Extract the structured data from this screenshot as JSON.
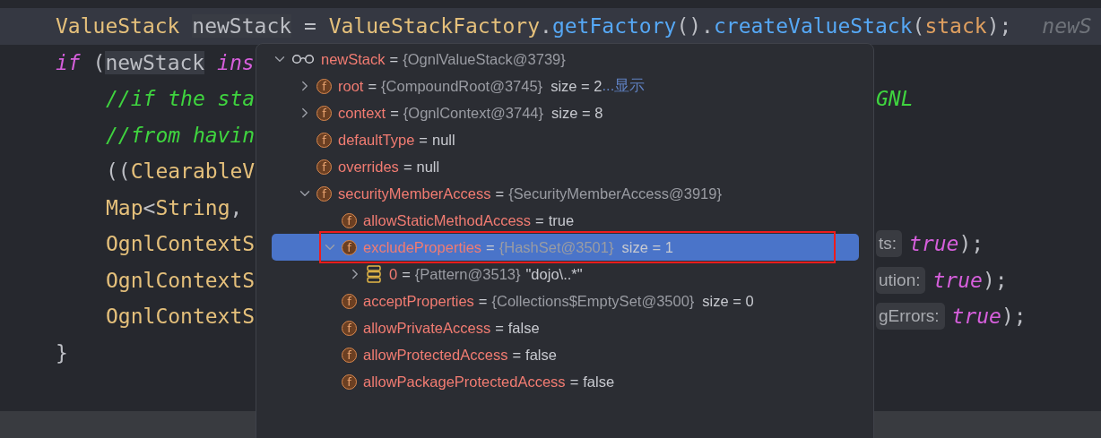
{
  "code_lines": [
    {
      "current": true,
      "kind": "method_level",
      "left": [
        {
          "text": "ValueStack ",
          "kind": "type"
        },
        {
          "text": "newStack",
          "kind": "var_highlight"
        },
        {
          "text": " = "
        },
        {
          "text": "ValueStackFactory",
          "kind": "type"
        },
        {
          "text": "."
        },
        {
          "text": "getFactory",
          "kind": "method"
        },
        {
          "text": "()."
        },
        {
          "text": "createValueStack",
          "kind": "method"
        },
        {
          "text": "("
        },
        {
          "text": "stack",
          "kind": "param"
        },
        {
          "text": ");"
        }
      ],
      "inline_hint": "newS"
    },
    {
      "current": false,
      "kind": "method_level",
      "left": [
        {
          "text": "if",
          "kind": "keyword"
        },
        {
          "text": " ("
        },
        {
          "text": "newStack",
          "kind": "var_highlight"
        },
        {
          "text": " ins",
          "kind": "keyword"
        }
      ]
    },
    {
      "current": false,
      "kind": "block_level",
      "left": [
        {
          "text": "//if the sta",
          "kind": "comment"
        }
      ],
      "right": [
        {
          "text": "GNL",
          "kind": "comment"
        }
      ]
    },
    {
      "current": false,
      "kind": "block_level",
      "left": [
        {
          "text": "//from havin",
          "kind": "comment"
        }
      ]
    },
    {
      "current": false,
      "kind": "block_level",
      "left": [
        {
          "text": "(("
        },
        {
          "text": "ClearableV",
          "kind": "type"
        }
      ]
    },
    {
      "current": false,
      "kind": "block_level",
      "left": [
        {
          "text": "Map",
          "kind": "type"
        },
        {
          "text": "<"
        },
        {
          "text": "String",
          "kind": "type"
        },
        {
          "text": ","
        }
      ]
    },
    {
      "current": false,
      "kind": "block_level",
      "left": [
        {
          "text": "OgnlContextS",
          "kind": "type"
        }
      ],
      "hint": "ts:",
      "right": [
        {
          "text": "true",
          "kind": "keyword"
        },
        {
          "text": ");"
        }
      ]
    },
    {
      "current": false,
      "kind": "block_level",
      "left": [
        {
          "text": "OgnlContextS",
          "kind": "type"
        }
      ],
      "hint": "ution:",
      "right": [
        {
          "text": "true",
          "kind": "keyword"
        },
        {
          "text": ");"
        }
      ]
    },
    {
      "current": false,
      "kind": "block_level",
      "left": [
        {
          "text": "OgnlContextS",
          "kind": "type"
        }
      ],
      "hint": "gErrors:",
      "right": [
        {
          "text": "true",
          "kind": "keyword"
        },
        {
          "text": ");"
        }
      ]
    },
    {
      "current": false,
      "kind": "method_level",
      "left": [
        {
          "text": "}"
        }
      ]
    }
  ],
  "debug_popup": {
    "tree": [
      {
        "kind": "watch",
        "name": "newStack",
        "op": "=",
        "ref": "{OgnlValueStack@3739}",
        "expanded": true,
        "selected": false,
        "children": [
          {
            "kind": "field",
            "badge": "f",
            "name": "root",
            "op": "=",
            "ref": "{CompoundRoot@3745}",
            "extra": "size = 2",
            "more": "...显示",
            "expanded": false,
            "selected": false
          },
          {
            "kind": "field",
            "badge": "f",
            "name": "context",
            "op": "=",
            "ref": "{OgnlContext@3744}",
            "extra": "size = 8",
            "expanded": false,
            "selected": false
          },
          {
            "kind": "field",
            "badge": "f",
            "name": "defaultType",
            "op": "=",
            "value": "null",
            "selected": false
          },
          {
            "kind": "field",
            "badge": "f",
            "name": "overrides",
            "op": "=",
            "value": "null",
            "selected": false
          },
          {
            "kind": "field",
            "badge": "f",
            "name": "securityMemberAccess",
            "op": "=",
            "ref": "{SecurityMemberAccess@3919}",
            "expanded": true,
            "selected": false,
            "children": [
              {
                "kind": "field",
                "badge": "f",
                "name": "allowStaticMethodAccess",
                "op": "=",
                "value": "true",
                "selected": false
              },
              {
                "kind": "field",
                "badge": "f",
                "name": "excludeProperties",
                "op": "=",
                "ref": "{HashSet@3501}",
                "extra": "size = 1",
                "expanded": true,
                "selected": true,
                "outlined": true,
                "children": [
                  {
                    "kind": "array",
                    "name": "0",
                    "op": "=",
                    "ref": "{Pattern@3513}",
                    "value": "\"dojo\\..*\"",
                    "expanded": false,
                    "selected": false
                  }
                ]
              },
              {
                "kind": "field",
                "badge": "f",
                "name": "acceptProperties",
                "op": "=",
                "ref": "{Collections$EmptySet@3500}",
                "extra": "size = 0",
                "selected": false
              },
              {
                "kind": "field",
                "badge": "f",
                "name": "allowPrivateAccess",
                "op": "=",
                "value": "false",
                "selected": false
              },
              {
                "kind": "field",
                "badge": "f",
                "name": "allowProtectedAccess",
                "op": "=",
                "value": "false",
                "selected": false
              },
              {
                "kind": "field",
                "badge": "f",
                "name": "allowPackageProtectedAccess",
                "op": "=",
                "value": "false",
                "selected": false
              }
            ]
          }
        ]
      }
    ]
  }
}
